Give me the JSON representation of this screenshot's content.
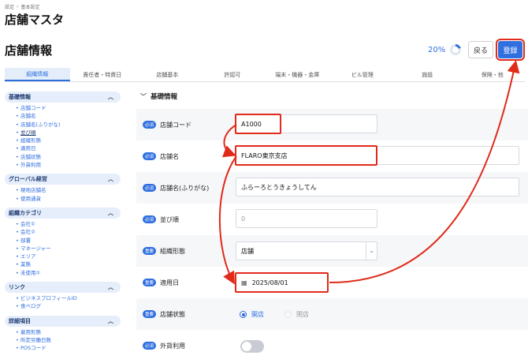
{
  "breadcrumb": [
    "設定",
    "基本設定"
  ],
  "page_title": "店舗マスタ",
  "section_title": "店舗情報",
  "progress": {
    "label": "20%",
    "value": 0.2
  },
  "buttons": {
    "back": "戻る",
    "save": "登録"
  },
  "tabs": [
    "組織情報",
    "責任者・特資日",
    "店舗基本",
    "許認可",
    "端末・機器・金庫",
    "ビル管理",
    "施設",
    "保険・他"
  ],
  "sidebar": [
    {
      "title": "基礎情報",
      "items": [
        "店舗コード",
        "店舗名",
        "店舗名(ふりがな)",
        "並び順",
        "組織形態",
        "適用日",
        "店舗状態",
        "外貨利用"
      ],
      "current": 3
    },
    {
      "title": "グローバル経営",
      "items": [
        "現地店舗名",
        "使用通貨"
      ]
    },
    {
      "title": "組織カテゴリ",
      "items": [
        "会社①",
        "会社②",
        "部署",
        "マネージャー",
        "エリア",
        "業態",
        "未使用①"
      ]
    },
    {
      "title": "リンク",
      "items": [
        "ビジネスプロフィールID",
        "食べログ"
      ]
    },
    {
      "title": "詳細項目",
      "items": [
        "雇用形態",
        "所定労働日数",
        "POSコード"
      ]
    }
  ],
  "form": {
    "heading": "基礎情報",
    "badges": {
      "required": "必須",
      "important": "重要"
    },
    "store_code": {
      "label": "店舗コード",
      "value": "A1000"
    },
    "store_name": {
      "label": "店舗名",
      "value": "FLARO東京支店"
    },
    "store_kana": {
      "label": "店舗名(ふりがな)",
      "value": "ふらーろとうきょうしてん"
    },
    "sort_order": {
      "label": "並び順",
      "placeholder": "0"
    },
    "org_type": {
      "label": "組織形態",
      "value": "店舗"
    },
    "effective_date": {
      "label": "適用日",
      "value": "2025/08/01"
    },
    "store_status": {
      "label": "店舗状態",
      "options": [
        "開店",
        "閉店"
      ],
      "selected": "開店"
    },
    "foreign_currency": {
      "label": "外貨利用",
      "enabled": false
    }
  },
  "colors": {
    "accent": "#2f6fe0",
    "annotation": "#e02a1a"
  },
  "icons": [
    "chevron-up-icon",
    "chevron-down-icon",
    "calendar-icon",
    "progress-ring-icon"
  ]
}
